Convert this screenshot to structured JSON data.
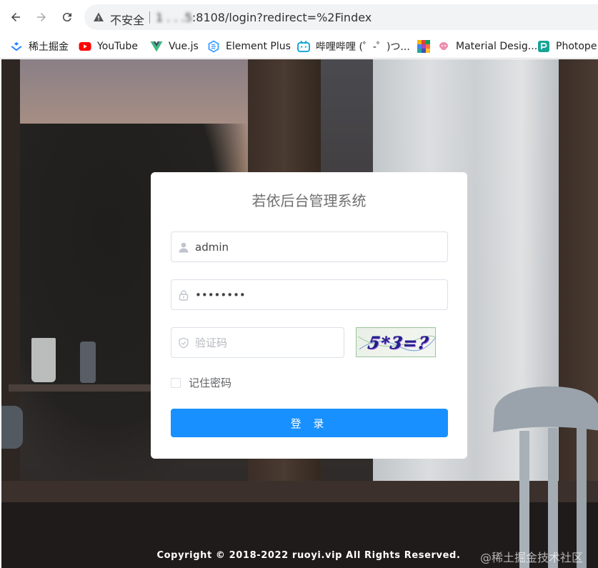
{
  "browser": {
    "insecure_label": "不安全",
    "url_host": "1  .   .  .5",
    "url_rest": ":8108/login?redirect=%2Findex",
    "bookmarks": [
      {
        "label": "稀土掘金",
        "icon": "juejin-icon"
      },
      {
        "label": "YouTube",
        "icon": "youtube-icon"
      },
      {
        "label": "Vue.js",
        "icon": "vue-icon"
      },
      {
        "label": "Element Plus",
        "icon": "element-plus-icon"
      },
      {
        "label": "哔哩哔哩 (゜-゜)つ...",
        "icon": "bilibili-icon"
      },
      {
        "label": "",
        "icon": "color-grid-icon"
      },
      {
        "label": "Material Desig...",
        "icon": "material-design-icon"
      },
      {
        "label": "Photope",
        "icon": "photopea-icon"
      }
    ]
  },
  "login": {
    "title": "若依后台管理系统",
    "username": "admin",
    "password": "••••••••",
    "code_placeholder": "验证码",
    "captcha_text": "5*3=?",
    "remember_label": "记住密码",
    "submit_label": "登 录"
  },
  "footer": {
    "copyright": "Copyright © 2018-2022 ruoyi.vip All Rights Reserved.",
    "watermark": "@稀土掘金技术社区"
  },
  "colors": {
    "primary": "#1890ff",
    "card": "#ffffff",
    "border": "#dcdfe6"
  }
}
